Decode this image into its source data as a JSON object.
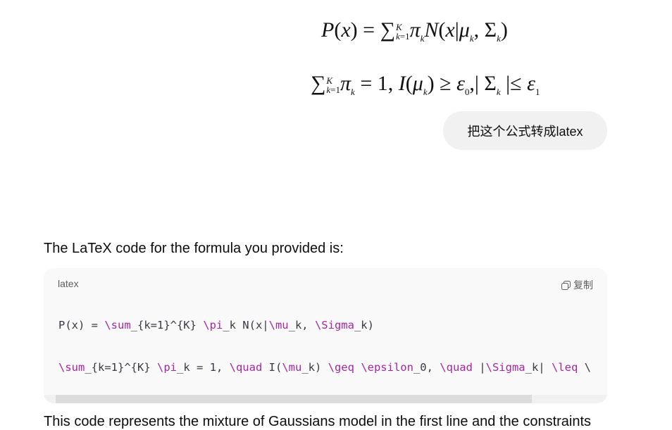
{
  "formula_image": {
    "line1": "P(x) = ∑_{k=1}^K π_k N(x|μ_k, Σ_k)",
    "line2": "∑_{k=1}^K π_k = 1, I(μ_k) ≥ ε_0, |Σ_k| ≤ ε_1"
  },
  "user_message": "把这个公式转成latex",
  "assistant": {
    "intro": "The LaTeX code for the formula you provided is:",
    "code_block": {
      "language": "latex",
      "copy_label": "复制",
      "line1": "P(x) = \\sum_{k=1}^{K} \\pi_k N(x|\\mu_k, \\Sigma_k)",
      "line2": "\\sum_{k=1}^{K} \\pi_k = 1, \\quad I(\\mu_k) \\geq \\epsilon_0, \\quad |\\Sigma_k| \\leq \\"
    },
    "outro": "This code represents the mixture of Gaussians model in the first line and the constraints"
  },
  "colors": {
    "bubble_bg": "#f1f1f1",
    "code_bg": "#f9f9f9",
    "keyword": "#a626a4"
  }
}
